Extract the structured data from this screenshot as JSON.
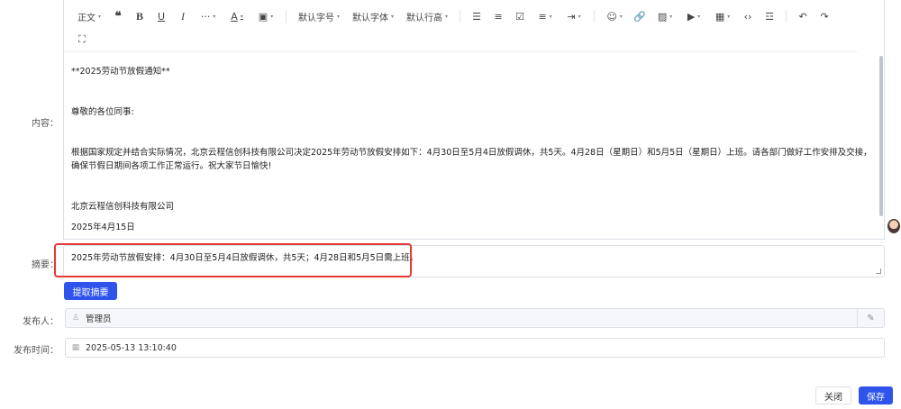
{
  "toolbar": {
    "row1": [
      {
        "name": "paragraph-dropdown",
        "label": "正文",
        "caret": true
      },
      {
        "name": "quote-button",
        "label": "❝",
        "cls": "tb-quote"
      },
      {
        "name": "bold-button",
        "label": "B",
        "cls": "tb-bold"
      },
      {
        "name": "underline-button",
        "label": "U",
        "cls": "tb-ul"
      },
      {
        "name": "italic-button",
        "label": "I",
        "cls": "tb-italic"
      },
      {
        "name": "more-format-dropdown",
        "label": "···",
        "caret": true
      },
      {
        "name": "font-color-dropdown",
        "label": "A",
        "caret": true,
        "cls": "tb-ul"
      },
      {
        "name": "bg-color-dropdown",
        "label": "▣",
        "caret": true
      },
      {
        "sep": true
      },
      {
        "name": "font-size-dropdown",
        "label": "默认字号",
        "caret": true
      },
      {
        "name": "font-family-dropdown",
        "label": "默认字体",
        "caret": true
      },
      {
        "name": "line-height-dropdown",
        "label": "默认行高",
        "caret": true
      },
      {
        "sep": true
      },
      {
        "name": "bullet-list-icon",
        "label": "☰"
      },
      {
        "name": "numbered-list-icon",
        "label": "≡"
      },
      {
        "name": "todo-list-icon",
        "label": "☑"
      },
      {
        "name": "align-dropdown",
        "label": "≡",
        "caret": true
      },
      {
        "name": "indent-dropdown",
        "label": "⇥",
        "caret": true
      },
      {
        "sep": true
      },
      {
        "name": "emoji-dropdown",
        "label": "☺",
        "caret": true
      },
      {
        "name": "link-icon",
        "label": "🔗"
      },
      {
        "name": "image-dropdown",
        "label": "▨",
        "caret": true
      },
      {
        "name": "video-dropdown",
        "label": "▶",
        "caret": true
      },
      {
        "name": "table-dropdown",
        "label": "▦",
        "caret": true
      },
      {
        "name": "code-icon",
        "label": "‹›"
      },
      {
        "name": "divider-icon",
        "label": "☲"
      },
      {
        "sep": true
      },
      {
        "name": "undo-icon",
        "label": "↶"
      },
      {
        "name": "redo-icon",
        "label": "↷"
      }
    ],
    "row2": [
      {
        "name": "fullscreen-icon",
        "label": "⛶"
      }
    ]
  },
  "labels": {
    "content": "内容：",
    "summary": "摘要：",
    "publisher": "发布人：",
    "publish_time": "发布时间："
  },
  "content": {
    "title": "**2025劳动节放假通知**",
    "greeting": "尊敬的各位同事:",
    "body": "根据国家规定并结合实际情况，北京云程信创科技有限公司决定2025年劳动节放假安排如下：4月30日至5月4日放假调休，共5天。4月28日（星期日）和5月5日（星期日）上班。请各部门做好工作安排及交接，确保节假日期间各项工作正常运行。祝大家节日愉快!",
    "signature": "北京云程信创科技有限公司",
    "date": "2025年4月15日"
  },
  "summary": {
    "value": "2025年劳动节放假安排：4月30日至5月4日放假调休，共5天；4月28日和5月5日需上班。"
  },
  "buttons": {
    "extract": "提取摘要",
    "close": "关闭",
    "save": "保存"
  },
  "publisher": {
    "value": "管理员",
    "icon": "user-icon"
  },
  "publish_time": {
    "value": "2025-05-13 13:10:40",
    "icon": "calendar-icon"
  },
  "colors": {
    "primary": "#2f54eb",
    "highlight": "#e53935"
  }
}
